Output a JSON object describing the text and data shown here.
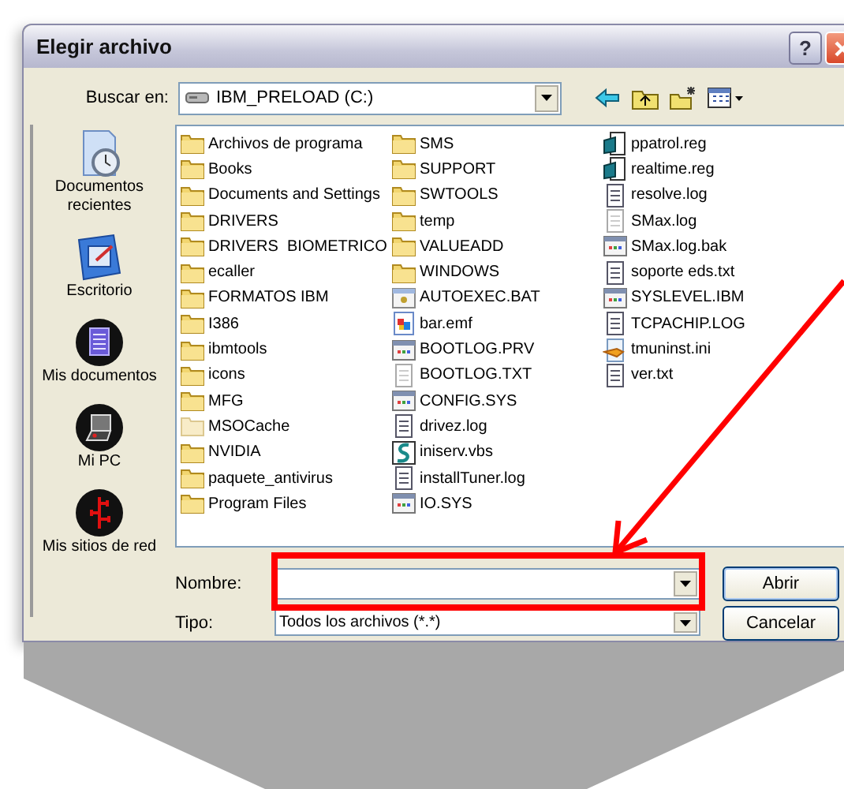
{
  "window": {
    "title": "Elegir archivo",
    "help": "?"
  },
  "location": {
    "label": "Buscar en:",
    "value": "IBM_PRELOAD (C:)"
  },
  "places": [
    {
      "kind": "recent",
      "label": "Documentos recientes"
    },
    {
      "kind": "desktop",
      "label": "Escritorio"
    },
    {
      "kind": "documents",
      "label": "Mis documentos"
    },
    {
      "kind": "computer",
      "label": "Mi PC"
    },
    {
      "kind": "network",
      "label": "Mis sitios de red"
    }
  ],
  "files": [
    {
      "kind": "folder",
      "name": "Archivos de programa"
    },
    {
      "kind": "folder",
      "name": "Books"
    },
    {
      "kind": "folder",
      "name": "Documents and Settings"
    },
    {
      "kind": "folder",
      "name": "DRIVERS"
    },
    {
      "kind": "folder",
      "name": "DRIVERS  BIOMETRICO"
    },
    {
      "kind": "folder",
      "name": "ecaller"
    },
    {
      "kind": "folder",
      "name": "FORMATOS IBM"
    },
    {
      "kind": "folder",
      "name": "I386"
    },
    {
      "kind": "folder",
      "name": "ibmtools"
    },
    {
      "kind": "folder",
      "name": "icons"
    },
    {
      "kind": "folder",
      "name": "MFG"
    },
    {
      "kind": "hidden-folder",
      "name": "MSOCache"
    },
    {
      "kind": "folder",
      "name": "NVIDIA"
    },
    {
      "kind": "folder",
      "name": "paquete_antivirus"
    },
    {
      "kind": "folder",
      "name": "Program Files"
    },
    {
      "kind": "folder",
      "name": "SMS"
    },
    {
      "kind": "folder",
      "name": "SUPPORT"
    },
    {
      "kind": "folder",
      "name": "SWTOOLS"
    },
    {
      "kind": "folder",
      "name": "temp"
    },
    {
      "kind": "folder",
      "name": "VALUEADD"
    },
    {
      "kind": "folder",
      "name": "WINDOWS"
    },
    {
      "kind": "batch",
      "name": "AUTOEXEC.BAT"
    },
    {
      "kind": "image",
      "name": "bar.emf"
    },
    {
      "kind": "system",
      "name": "BOOTLOG.PRV"
    },
    {
      "kind": "plain",
      "name": "BOOTLOG.TXT"
    },
    {
      "kind": "system",
      "name": "CONFIG.SYS"
    },
    {
      "kind": "text",
      "name": "drivez.log"
    },
    {
      "kind": "script",
      "name": "iniserv.vbs"
    },
    {
      "kind": "text",
      "name": "installTuner.log"
    },
    {
      "kind": "system",
      "name": "IO.SYS"
    },
    {
      "kind": "registry",
      "name": "ppatrol.reg"
    },
    {
      "kind": "registry",
      "name": "realtime.reg"
    },
    {
      "kind": "text",
      "name": "resolve.log"
    },
    {
      "kind": "plain",
      "name": "SMax.log"
    },
    {
      "kind": "system",
      "name": "SMax.log.bak"
    },
    {
      "kind": "text",
      "name": "soporte eds.txt"
    },
    {
      "kind": "system",
      "name": "SYSLEVEL.IBM"
    },
    {
      "kind": "text",
      "name": "TCPACHIP.LOG"
    },
    {
      "kind": "settings",
      "name": "tmuninst.ini"
    },
    {
      "kind": "text",
      "name": "ver.txt"
    }
  ],
  "filename": {
    "label": "Nombre:"
  },
  "filetype": {
    "label": "Tipo:",
    "value": "Todos los archivos (*.*)"
  },
  "buttons": [
    "Abrir",
    "Cancelar"
  ],
  "annotations": [
    {
      "kind": "chevron"
    },
    {
      "kind": "arrow"
    },
    {
      "kind": "box"
    }
  ]
}
